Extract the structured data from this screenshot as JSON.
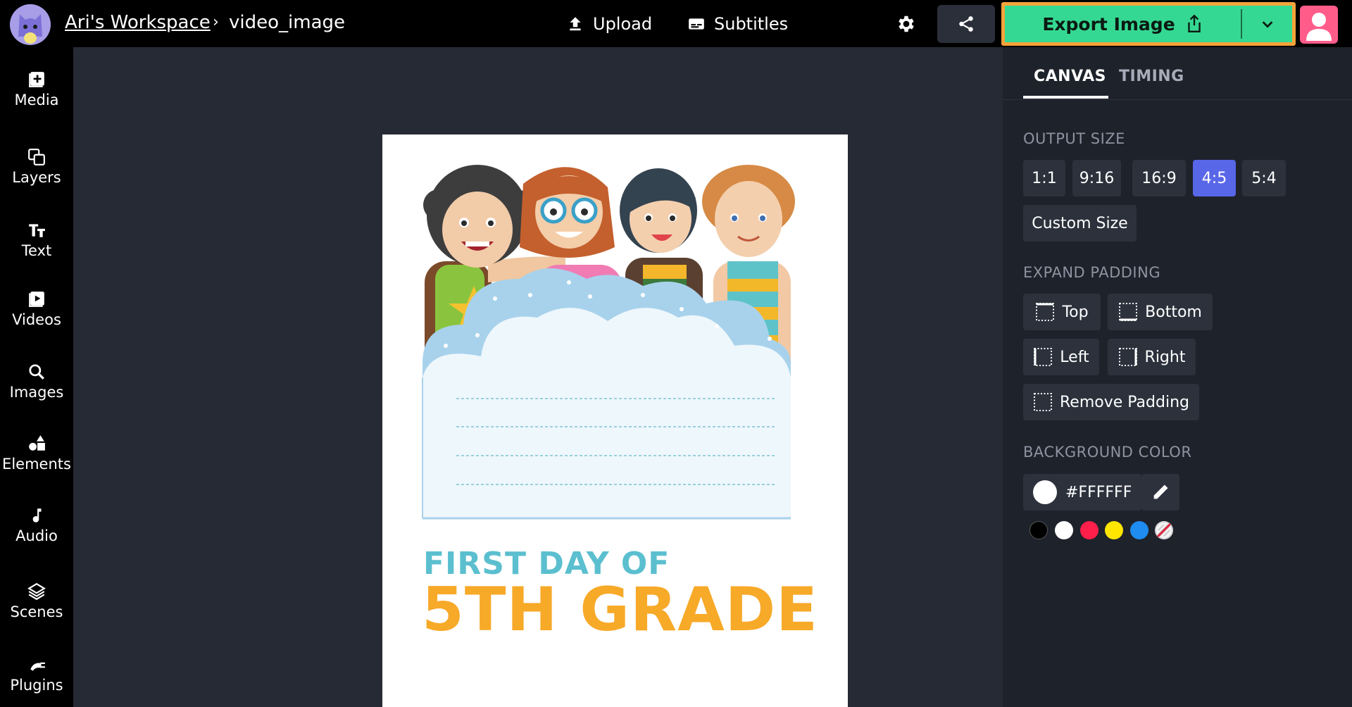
{
  "header": {
    "workspace": "Ari's Workspace",
    "separator": "›",
    "project": "video_image",
    "upload_label": "Upload",
    "subtitles_label": "Subtitles",
    "export_label": "Export Image"
  },
  "sidebar": {
    "items": [
      {
        "label": "Media",
        "icon": "media-plus-icon"
      },
      {
        "label": "Layers",
        "icon": "layers-icon"
      },
      {
        "label": "Text",
        "icon": "text-icon"
      },
      {
        "label": "Videos",
        "icon": "video-icon"
      },
      {
        "label": "Images",
        "icon": "search-icon"
      },
      {
        "label": "Elements",
        "icon": "shapes-icon"
      },
      {
        "label": "Audio",
        "icon": "music-note-icon"
      },
      {
        "label": "Scenes",
        "icon": "stack-icon"
      },
      {
        "label": "Plugins",
        "icon": "plug-icon"
      }
    ]
  },
  "canvas": {
    "line1": "FIRST DAY OF",
    "line2": "5TH GRADE",
    "colors": {
      "teal": "#5bbfcf",
      "orange": "#f7a928"
    }
  },
  "panel": {
    "tabs": [
      "CANVAS",
      "TIMING"
    ],
    "output_size_title": "OUTPUT SIZE",
    "sizes": [
      "1:1",
      "9:16",
      "16:9",
      "4:5",
      "5:4"
    ],
    "active_size": "4:5",
    "custom_size": "Custom Size",
    "expand_padding_title": "EXPAND PADDING",
    "padding": {
      "top": "Top",
      "bottom": "Bottom",
      "left": "Left",
      "right": "Right",
      "remove": "Remove Padding"
    },
    "background_title": "BACKGROUND COLOR",
    "background_hex": "#FFFFFF",
    "swatches": [
      "#000000",
      "#ffffff",
      "#ff1f4b",
      "#ffe600",
      "#1e8cf0"
    ]
  },
  "colors": {
    "accent": "#35d892",
    "highlight": "#f5a33a",
    "active": "#5866e8"
  }
}
